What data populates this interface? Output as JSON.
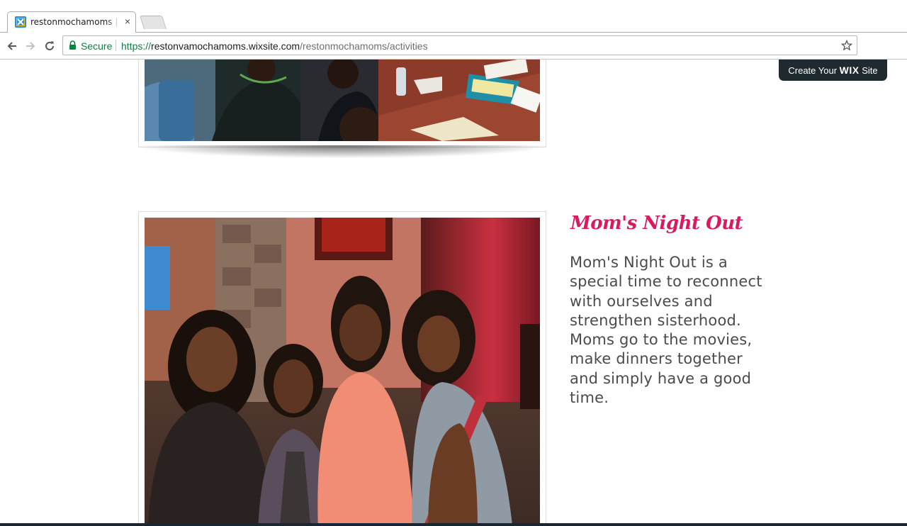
{
  "browser": {
    "tab_title": "restonmochamoms | Activities",
    "tab_close": "×",
    "secure_label": "Secure",
    "url_scheme": "https://",
    "url_host": "restonvamochamoms.wixsite.com",
    "url_path": "/restonmochamoms/activities"
  },
  "wix_banner": {
    "prefix": "Create Your ",
    "brand": "WIX",
    "suffix": " Site"
  },
  "activity": {
    "title": "Mom's Night Out",
    "description": "Mom's Night Out is a special time to reconnect with ourselves and strengthen sisterhood. Moms go to the movies, make dinners together and simply have a good time."
  },
  "colors": {
    "title_pink": "#d81b60",
    "body_text": "#4b4b4b",
    "secure_green": "#0b8043",
    "wix_banner_bg": "#1e2930"
  },
  "icons": {
    "favicon": "wix-favicon-icon",
    "back": "arrow-left-icon",
    "forward": "arrow-right-icon",
    "reload": "reload-icon",
    "lock": "lock-icon",
    "bookmark": "star-icon"
  }
}
